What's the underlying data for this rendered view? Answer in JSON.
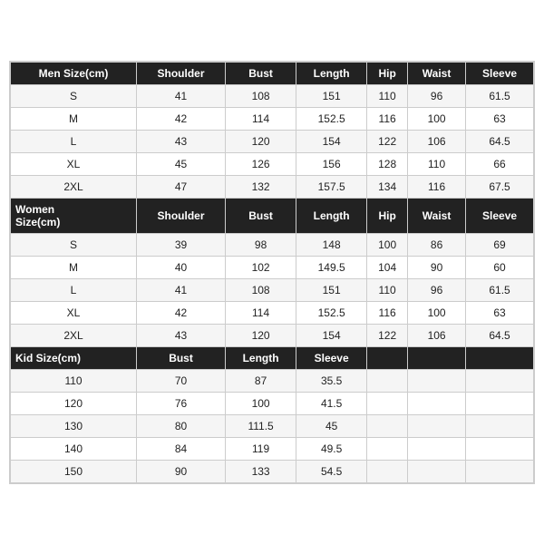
{
  "men": {
    "label": "Men Size(cm)",
    "columns": [
      "Shoulder",
      "Bust",
      "Length",
      "Hip",
      "Waist",
      "Sleeve"
    ],
    "rows": [
      {
        "size": "S",
        "shoulder": "41",
        "bust": "108",
        "length": "151",
        "hip": "110",
        "waist": "96",
        "sleeve": "61.5"
      },
      {
        "size": "M",
        "shoulder": "42",
        "bust": "114",
        "length": "152.5",
        "hip": "116",
        "waist": "100",
        "sleeve": "63"
      },
      {
        "size": "L",
        "shoulder": "43",
        "bust": "120",
        "length": "154",
        "hip": "122",
        "waist": "106",
        "sleeve": "64.5"
      },
      {
        "size": "XL",
        "shoulder": "45",
        "bust": "126",
        "length": "156",
        "hip": "128",
        "waist": "110",
        "sleeve": "66"
      },
      {
        "size": "2XL",
        "shoulder": "47",
        "bust": "132",
        "length": "157.5",
        "hip": "134",
        "waist": "116",
        "sleeve": "67.5"
      }
    ]
  },
  "women": {
    "label": "Women\nSize(cm)",
    "columns": [
      "Shoulder",
      "Bust",
      "Length",
      "Hip",
      "Waist",
      "Sleeve"
    ],
    "rows": [
      {
        "size": "S",
        "shoulder": "39",
        "bust": "98",
        "length": "148",
        "hip": "100",
        "waist": "86",
        "sleeve": "69"
      },
      {
        "size": "M",
        "shoulder": "40",
        "bust": "102",
        "length": "149.5",
        "hip": "104",
        "waist": "90",
        "sleeve": "60"
      },
      {
        "size": "L",
        "shoulder": "41",
        "bust": "108",
        "length": "151",
        "hip": "110",
        "waist": "96",
        "sleeve": "61.5"
      },
      {
        "size": "XL",
        "shoulder": "42",
        "bust": "114",
        "length": "152.5",
        "hip": "116",
        "waist": "100",
        "sleeve": "63"
      },
      {
        "size": "2XL",
        "shoulder": "43",
        "bust": "120",
        "length": "154",
        "hip": "122",
        "waist": "106",
        "sleeve": "64.5"
      }
    ]
  },
  "kid": {
    "label": "Kid Size(cm)",
    "columns": [
      "Bust",
      "Length",
      "Sleeve"
    ],
    "rows": [
      {
        "size": "110",
        "bust": "70",
        "length": "87",
        "sleeve": "35.5"
      },
      {
        "size": "120",
        "bust": "76",
        "length": "100",
        "sleeve": "41.5"
      },
      {
        "size": "130",
        "bust": "80",
        "length": "111.5",
        "sleeve": "45"
      },
      {
        "size": "140",
        "bust": "84",
        "length": "119",
        "sleeve": "49.5"
      },
      {
        "size": "150",
        "bust": "90",
        "length": "133",
        "sleeve": "54.5"
      }
    ]
  }
}
